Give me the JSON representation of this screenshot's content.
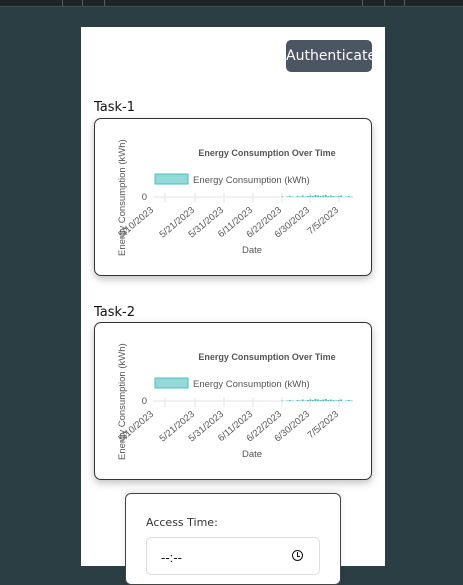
{
  "header": {
    "authenticate_label": "Authenticate"
  },
  "tasks": [
    {
      "label": "Task-1"
    },
    {
      "label": "Task-2"
    }
  ],
  "chart_data": [
    {
      "type": "bar",
      "title": "Energy Consumption Over Time",
      "legend": "Energy Consumption (kWh)",
      "xlabel": "Date",
      "ylabel": "Energy Consumption (kWh)",
      "yticks": [
        "0"
      ],
      "x_ticks": [
        "5/10/2023",
        "5/21/2023",
        "5/31/2023",
        "6/11/2023",
        "6/22/2023",
        "6/30/2023",
        "7/5/2023"
      ],
      "values": [
        0,
        0,
        0,
        0,
        0,
        0,
        0,
        0,
        0,
        0,
        0,
        0,
        0,
        0,
        0,
        0,
        0,
        0,
        0,
        0,
        0,
        0,
        0,
        0,
        0,
        0,
        0,
        0,
        0,
        0,
        0,
        0,
        0,
        0,
        0,
        0,
        0,
        0,
        0,
        0,
        0,
        0,
        0,
        0,
        0,
        0,
        0,
        0,
        0,
        0,
        0.1,
        0,
        0.1,
        0.2,
        0.1,
        0,
        0.2,
        0.1,
        0.3,
        0.1,
        0.2,
        0.3,
        0.2,
        0.4,
        0.3,
        0.2,
        0.3,
        0.4,
        0.2,
        0.3,
        0.2,
        0.1,
        0.2,
        0.3,
        0,
        0.1,
        0.2,
        0.1
      ],
      "color": "#4bc0c0"
    },
    {
      "type": "bar",
      "title": "Energy Consumption Over Time",
      "legend": "Energy Consumption (kWh)",
      "xlabel": "Date",
      "ylabel": "Energy Consumption (kWh)",
      "yticks": [
        "0"
      ],
      "x_ticks": [
        "5/10/2023",
        "5/21/2023",
        "5/31/2023",
        "6/11/2023",
        "6/22/2023",
        "6/30/2023",
        "7/5/2023"
      ],
      "values": [
        0,
        0,
        0,
        0,
        0,
        0,
        0,
        0,
        0,
        0,
        0,
        0,
        0,
        0,
        0,
        0,
        0,
        0,
        0,
        0,
        0,
        0,
        0,
        0,
        0,
        0,
        0,
        0,
        0,
        0,
        0,
        0,
        0,
        0,
        0,
        0,
        0,
        0,
        0,
        0,
        0,
        0,
        0,
        0,
        0,
        0,
        0,
        0,
        0,
        0,
        0.1,
        0,
        0.1,
        0.2,
        0.1,
        0,
        0.2,
        0.1,
        0.3,
        0.1,
        0.2,
        0.3,
        0.2,
        0.4,
        0.3,
        0.2,
        0.3,
        0.4,
        0.2,
        0.3,
        0.2,
        0.1,
        0.2,
        0.3,
        0,
        0.1,
        0.2,
        0.1
      ],
      "color": "#4bc0c0"
    }
  ],
  "access": {
    "label": "Access Time:",
    "value": "--:--"
  }
}
